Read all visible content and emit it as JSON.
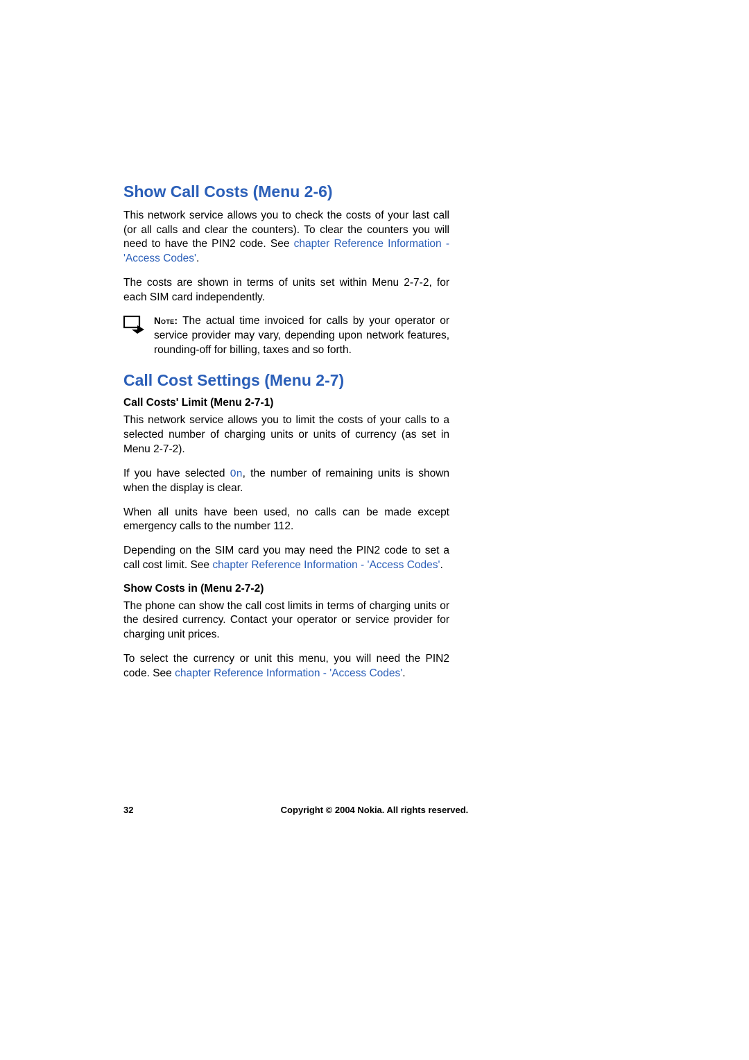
{
  "section1": {
    "title": "Show Call Costs (Menu 2-6)",
    "p1_a": "This network service allows you to check the costs of your last call (or all calls and clear the counters). To clear the counters you will need to have the PIN2 code. See ",
    "p1_link": "chapter Reference Information - 'Access Codes'",
    "p1_b": ".",
    "p2": "The costs are shown in terms of units set within Menu 2-7-2, for each SIM card independently.",
    "note_label": "Note: ",
    "note_text": "The actual time invoiced for calls by your operator or service provider may vary, depending upon network features, rounding-off for billing, taxes and so forth."
  },
  "section2": {
    "title": "Call Cost Settings (Menu 2-7)",
    "sub1_title": "Call Costs' Limit (Menu 2-7-1)",
    "sub1_p1": "This network service allows you to limit the costs of your calls to a selected number of charging units or units of currency (as set in Menu 2-7-2).",
    "sub1_p2_a": "If you have selected ",
    "sub1_p2_on": "On",
    "sub1_p2_b": ", the number of remaining units is shown when the display is clear.",
    "sub1_p3": "When all units have been used, no calls can be made except emergency calls to the number 112.",
    "sub1_p4_a": "Depending on the SIM card you may need the PIN2 code to set a call cost limit. See ",
    "sub1_p4_link": "chapter Reference Information - 'Access Codes'",
    "sub1_p4_b": ".",
    "sub2_title": "Show Costs in (Menu 2-7-2)",
    "sub2_p1": "The phone can show the call cost limits in terms of charging units or the desired currency. Contact your operator or service provider for charging unit prices.",
    "sub2_p2_a": "To select the currency or unit this menu, you will need the PIN2 code. See ",
    "sub2_p2_link": "chapter Reference Information - 'Access Codes'",
    "sub2_p2_b": "."
  },
  "footer": {
    "page_number": "32",
    "copyright": "Copyright © 2004 Nokia. All rights reserved."
  }
}
